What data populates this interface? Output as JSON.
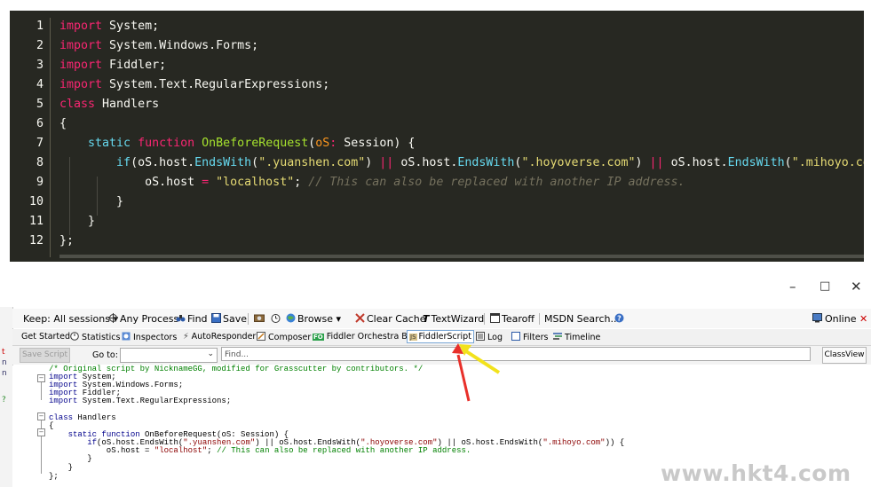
{
  "code_top": {
    "lines": [
      {
        "n": "1",
        "t": [
          {
            "c": "k",
            "v": "import"
          },
          {
            "c": "",
            "v": " System;"
          }
        ]
      },
      {
        "n": "2",
        "t": [
          {
            "c": "k",
            "v": "import"
          },
          {
            "c": "",
            "v": " System.Windows.Forms;"
          }
        ]
      },
      {
        "n": "3",
        "t": [
          {
            "c": "k",
            "v": "import"
          },
          {
            "c": "",
            "v": " Fiddler;"
          }
        ]
      },
      {
        "n": "4",
        "t": [
          {
            "c": "k",
            "v": "import"
          },
          {
            "c": "",
            "v": " System.Text.RegularExpressions;"
          }
        ]
      },
      {
        "n": "5",
        "t": [
          {
            "c": "k",
            "v": "class"
          },
          {
            "c": "",
            "v": " Handlers"
          }
        ]
      },
      {
        "n": "6",
        "t": [
          {
            "c": "",
            "v": "{"
          }
        ]
      },
      {
        "n": "7",
        "t": [
          {
            "c": "",
            "v": "    "
          },
          {
            "c": "f",
            "v": "static"
          },
          {
            "c": "",
            "v": " "
          },
          {
            "c": "k",
            "v": "function"
          },
          {
            "c": "",
            "v": " "
          },
          {
            "c": "fn",
            "v": "OnBeforeRequest"
          },
          {
            "c": "",
            "v": "("
          },
          {
            "c": "p",
            "v": "oS"
          },
          {
            "c": "o",
            "v": ":"
          },
          {
            "c": "",
            "v": " Session) {"
          }
        ]
      },
      {
        "n": "8",
        "t": [
          {
            "c": "",
            "v": "        "
          },
          {
            "c": "f",
            "v": "if"
          },
          {
            "c": "",
            "v": "(oS.host."
          },
          {
            "c": "f",
            "v": "EndsWith"
          },
          {
            "c": "",
            "v": "("
          },
          {
            "c": "s",
            "v": "\".yuanshen.com\""
          },
          {
            "c": "",
            "v": ") "
          },
          {
            "c": "o",
            "v": "||"
          },
          {
            "c": "",
            "v": " oS.host."
          },
          {
            "c": "f",
            "v": "EndsWith"
          },
          {
            "c": "",
            "v": "("
          },
          {
            "c": "s",
            "v": "\".hoyoverse.com\""
          },
          {
            "c": "",
            "v": ") "
          },
          {
            "c": "o",
            "v": "||"
          },
          {
            "c": "",
            "v": " oS.host."
          },
          {
            "c": "f",
            "v": "EndsWith"
          },
          {
            "c": "",
            "v": "("
          },
          {
            "c": "s",
            "v": "\".mihoyo.com\""
          }
        ]
      },
      {
        "n": "9",
        "t": [
          {
            "c": "",
            "v": "            oS.host "
          },
          {
            "c": "o",
            "v": "="
          },
          {
            "c": "",
            "v": " "
          },
          {
            "c": "s",
            "v": "\"localhost\""
          },
          {
            "c": "",
            "v": "; "
          },
          {
            "c": "c",
            "v": "// This can also be replaced with another IP address."
          }
        ]
      },
      {
        "n": "10",
        "t": [
          {
            "c": "",
            "v": "        }"
          }
        ]
      },
      {
        "n": "11",
        "t": [
          {
            "c": "",
            "v": "    }"
          }
        ]
      },
      {
        "n": "12",
        "t": [
          {
            "c": "",
            "v": "};"
          }
        ]
      }
    ]
  },
  "window_controls": {
    "minimize": "–",
    "maximize": "□",
    "close": "✕"
  },
  "left_strip": [
    "t",
    "n",
    "n",
    "?"
  ],
  "toolbar": {
    "keep": "Keep: All sessions ▾",
    "any_process": "Any Process",
    "find": "Find",
    "save": "Save",
    "browse": "Browse ▾",
    "clear_cache": "Clear Cache",
    "text_wizard": "TextWizard",
    "tearoff": "Tearoff",
    "msdn_search": "MSDN Search...",
    "online": "Online",
    "close_x": "✕"
  },
  "tabs": [
    {
      "label": "Get Started"
    },
    {
      "label": "Statistics"
    },
    {
      "label": "Inspectors"
    },
    {
      "label": "AutoResponder"
    },
    {
      "label": "Composer"
    },
    {
      "label": "Fiddler Orchestra Beta"
    },
    {
      "label": "FiddlerScript"
    },
    {
      "label": "Log"
    },
    {
      "label": "Filters"
    },
    {
      "label": "Timeline"
    }
  ],
  "script_bar": {
    "save_script": "Save Script",
    "goto_label": "Go to:",
    "find_placeholder": "Find...",
    "class_view": "ClassView"
  },
  "editor_lines": [
    [
      {
        "c": "ec",
        "v": "/* Original script by NicknameGG, modified for Grasscutter by contributors. */"
      }
    ],
    [
      {
        "c": "ek",
        "v": "import"
      },
      {
        "c": "",
        "v": " System;"
      }
    ],
    [
      {
        "c": "ek",
        "v": "import"
      },
      {
        "c": "",
        "v": " System.Windows.Forms;"
      }
    ],
    [
      {
        "c": "ek",
        "v": "import"
      },
      {
        "c": "",
        "v": " Fiddler;"
      }
    ],
    [
      {
        "c": "ek",
        "v": "import"
      },
      {
        "c": "",
        "v": " System.Text.RegularExpressions;"
      }
    ],
    [
      {
        "c": "ek",
        "v": "class"
      },
      {
        "c": "",
        "v": " Handlers"
      }
    ],
    [
      {
        "c": "",
        "v": "{"
      }
    ],
    [
      {
        "c": "",
        "v": "    "
      },
      {
        "c": "ek",
        "v": "static function"
      },
      {
        "c": "",
        "v": " OnBeforeRequest(oS: Session) {"
      }
    ],
    [
      {
        "c": "",
        "v": "        "
      },
      {
        "c": "ek",
        "v": "if"
      },
      {
        "c": "",
        "v": "(oS.host.EndsWith("
      },
      {
        "c": "es",
        "v": "\".yuanshen.com\""
      },
      {
        "c": "",
        "v": ") || oS.host.EndsWith("
      },
      {
        "c": "es",
        "v": "\".hoyoverse.com\""
      },
      {
        "c": "",
        "v": ") || oS.host.EndsWith("
      },
      {
        "c": "es",
        "v": "\".mihoyo.com\""
      },
      {
        "c": "",
        "v": ")) {"
      }
    ],
    [
      {
        "c": "",
        "v": "            oS.host = "
      },
      {
        "c": "es",
        "v": "\"localhost\""
      },
      {
        "c": "",
        "v": "; "
      },
      {
        "c": "ec",
        "v": "// This can also be replaced with another IP address."
      }
    ],
    [
      {
        "c": "",
        "v": "        }"
      }
    ],
    [
      {
        "c": "",
        "v": "    }"
      }
    ],
    [
      {
        "c": "",
        "v": "};"
      }
    ]
  ],
  "watermark": "www.hkt4.com",
  "colors": {
    "editor_bg": "#272822",
    "keyword": "#f92672",
    "string": "#e6db74",
    "func": "#66d9ef",
    "name": "#a6e22e",
    "comment": "#75715e",
    "arrow_red": "#e8302a",
    "arrow_yellow": "#f2e21c"
  },
  "icons": [
    "any-process-crosshair-icon",
    "find-binoculars-icon",
    "save-disk-icon",
    "camera-icon",
    "timer-icon",
    "browse-globe-icon",
    "clear-cache-icon",
    "text-wizard-icon",
    "tearoff-icon",
    "help-icon",
    "online-icon",
    "statistics-icon",
    "inspectors-icon",
    "autoresponder-icon",
    "composer-icon",
    "fiddler-orchestra-icon",
    "fiddlerscript-icon",
    "log-icon",
    "filters-icon",
    "timeline-icon"
  ]
}
